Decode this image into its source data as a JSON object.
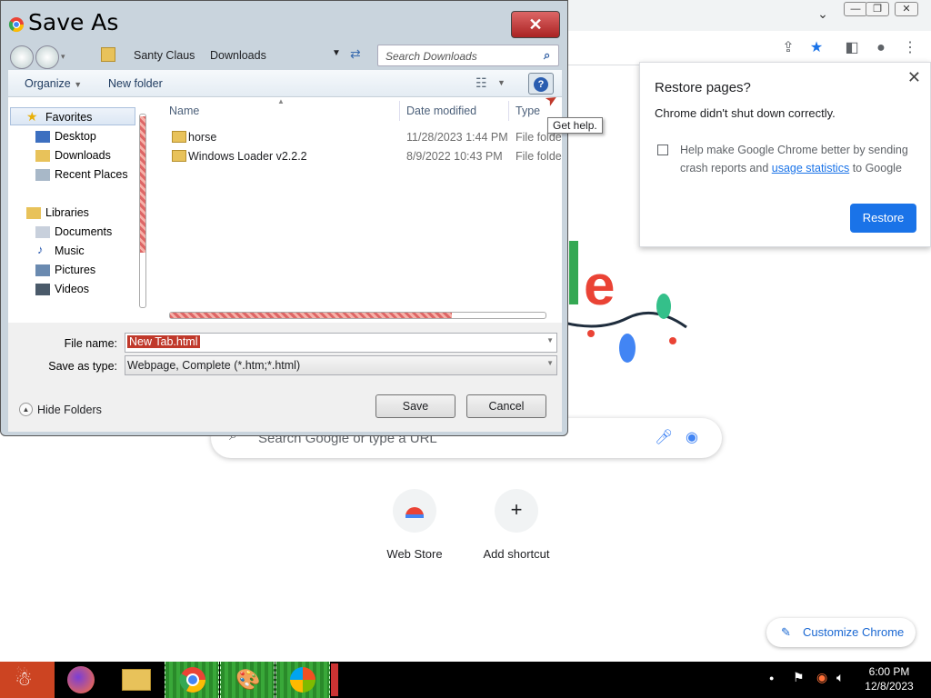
{
  "chrome": {
    "restore": {
      "title": "Restore pages?",
      "message": "Chrome didn't shut down correctly.",
      "help_prefix": "Help make Google Chrome better by sending crash reports and ",
      "help_link": "usage statistics",
      "help_suffix": " to Google",
      "button": "Restore"
    },
    "search_placeholder": "Search Google or type a URL",
    "shortcuts": [
      {
        "label": "Web Store"
      },
      {
        "label": "Add shortcut"
      }
    ],
    "customize_label": "Customize Chrome"
  },
  "dialog": {
    "title": "Save As",
    "breadcrumb": [
      "Santy Claus",
      "Downloads"
    ],
    "search_placeholder": "Search Downloads",
    "organize": "Organize",
    "new_folder": "New folder",
    "tooltip": "Get help.",
    "nav": {
      "favorites": "Favorites",
      "favorites_items": [
        "Desktop",
        "Downloads",
        "Recent Places"
      ],
      "libraries": "Libraries",
      "libraries_items": [
        "Documents",
        "Music",
        "Pictures",
        "Videos"
      ]
    },
    "columns": [
      "Name",
      "Date modified",
      "Type"
    ],
    "files": [
      {
        "name": "horse",
        "date": "11/28/2023 1:44 PM",
        "type": "File folder"
      },
      {
        "name": "Windows Loader v2.2.2",
        "date": "8/9/2022 10:43 PM",
        "type": "File folder"
      }
    ],
    "file_name_label": "File name:",
    "file_name_value": "New Tab.html",
    "save_type_label": "Save as type:",
    "save_type_value": "Webpage, Complete (*.htm;*.html)",
    "hide_folders": "Hide Folders",
    "save_button": "Save",
    "cancel_button": "Cancel"
  },
  "taskbar": {
    "time": "6:00 PM",
    "date": "12/8/2023"
  },
  "colors": {
    "chrome_blue": "#1a73e8",
    "dialog_frame": "#c9d4dd",
    "taskbar_active": "#39a839"
  }
}
